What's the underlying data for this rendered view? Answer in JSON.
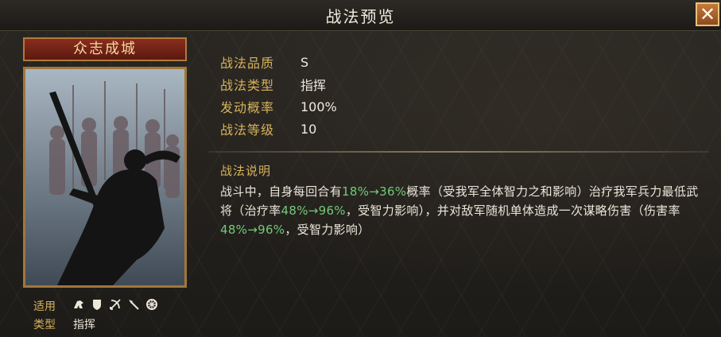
{
  "window": {
    "title": "战法预览"
  },
  "card": {
    "name": "众志成城"
  },
  "stats": [
    {
      "label": "战法品质",
      "value": "S"
    },
    {
      "label": "战法类型",
      "value": "指挥"
    },
    {
      "label": "发动概率",
      "value": "100%"
    },
    {
      "label": "战法等级",
      "value": "10"
    }
  ],
  "description": {
    "title": "战法说明",
    "segments": [
      "战斗中，自身每回合有",
      "18%→36%",
      "概率（受我军全体智力之和影响）治疗我军兵力最低武将（治疗率",
      "48%→96%",
      "，受智力影响），并对敌军随机单体造成一次谋略伤害（伤害率",
      "48%→96%",
      "，受智力影响）"
    ]
  },
  "footer": {
    "apply_label": "适用",
    "type_label": "类型",
    "type_value": "指挥",
    "unit_icons": [
      "cavalry-icon",
      "shield-icon",
      "bow-icon",
      "spear-icon",
      "siege-icon"
    ]
  },
  "colors": {
    "label_gold": "#d6b25a",
    "highlight_green": "#74c978",
    "close_orange": "#b8652c"
  }
}
